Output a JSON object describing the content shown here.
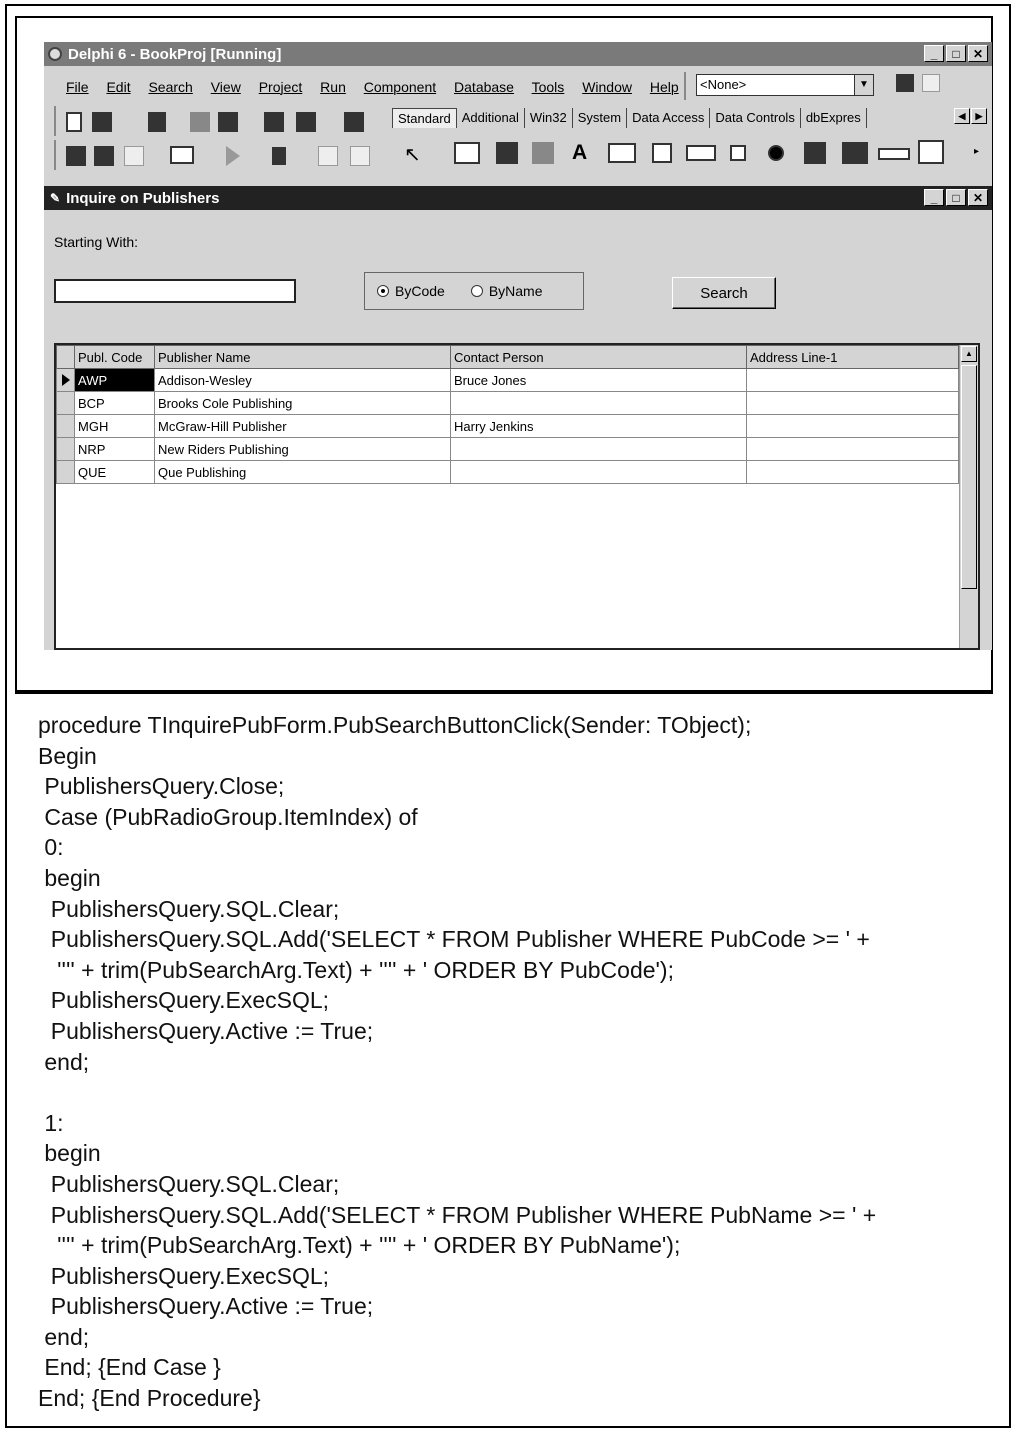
{
  "ide": {
    "title": "Delphi 6 - BookProj [Running]",
    "menu": [
      "File",
      "Edit",
      "Search",
      "View",
      "Project",
      "Run",
      "Component",
      "Database",
      "Tools",
      "Window",
      "Help"
    ],
    "config_combo": "<None>",
    "palette_tabs": [
      "Standard",
      "Additional",
      "Win32",
      "System",
      "Data Access",
      "Data Controls",
      "dbExpres"
    ]
  },
  "form": {
    "title": "Inquire on Publishers",
    "starting_with_label": "Starting With:",
    "search_value": "",
    "radio_bycode": "ByCode",
    "radio_byname": "ByName",
    "selected_radio": "ByCode",
    "search_button": "Search"
  },
  "grid": {
    "columns": [
      "Publ. Code",
      "Publisher Name",
      "Contact Person",
      "Address Line-1"
    ],
    "rows": [
      [
        "AWP",
        "Addison-Wesley",
        "Bruce Jones",
        ""
      ],
      [
        "BCP",
        "Brooks Cole Publishing",
        "",
        ""
      ],
      [
        "MGH",
        "McGraw-Hill Publisher",
        "Harry Jenkins",
        ""
      ],
      [
        "NRP",
        "New Riders Publishing",
        "",
        ""
      ],
      [
        "QUE",
        "Que Publishing",
        "",
        ""
      ]
    ]
  },
  "code": [
    "procedure TInquirePubForm.PubSearchButtonClick(Sender: TObject);",
    "Begin",
    " PublishersQuery.Close;",
    " Case (PubRadioGroup.ItemIndex) of",
    " 0:",
    " begin",
    "  PublishersQuery.SQL.Clear;",
    "  PublishersQuery.SQL.Add('SELECT * FROM Publisher WHERE PubCode >= ' +",
    "   '''' + trim(PubSearchArg.Text) + '''' + ' ORDER BY PubCode');",
    "  PublishersQuery.ExecSQL;",
    "  PublishersQuery.Active := True;",
    " end;",
    "",
    " 1:",
    " begin",
    "  PublishersQuery.SQL.Clear;",
    "  PublishersQuery.SQL.Add('SELECT * FROM Publisher WHERE PubName >= ' +",
    "   '''' + trim(PubSearchArg.Text) + '''' + ' ORDER BY PubName');",
    "  PublishersQuery.ExecSQL;",
    "  PublishersQuery.Active := True;",
    " end;",
    " End; {End Case }",
    "End; {End Procedure}"
  ]
}
